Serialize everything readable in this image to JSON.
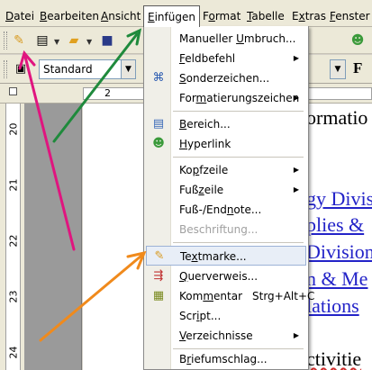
{
  "menubar": {
    "items": [
      {
        "label": "Datei",
        "u": "D"
      },
      {
        "label": "Bearbeiten",
        "u": "B"
      },
      {
        "label": "Ansicht",
        "u": "A"
      },
      {
        "label": "Einfügen",
        "u": "E"
      },
      {
        "label": "Format",
        "u": "o"
      },
      {
        "label": "Tabelle",
        "u": "T"
      },
      {
        "label": "Extras",
        "u": "x"
      },
      {
        "label": "Fenster",
        "u": "F"
      }
    ]
  },
  "toolbar": {
    "style_value": "Standard",
    "bold_label": "F",
    "icons": [
      "bookmark-icon",
      "new-document-icon",
      "open-folder-icon",
      "save-icon",
      "globe-icon"
    ]
  },
  "ruler": {
    "h_labels": [
      "1",
      "2",
      "1",
      "2"
    ],
    "v_labels": [
      "20",
      "21",
      "22",
      "23",
      "24"
    ]
  },
  "document": {
    "lines": [
      {
        "text": "ormatio",
        "class": ""
      },
      {
        "text": "gy Divis",
        "class": "blue"
      },
      {
        "text": "plies &",
        "class": "blue"
      },
      {
        "text": "Division",
        "class": "blue"
      },
      {
        "text": "n & Me",
        "class": "blue"
      },
      {
        "text": "lations",
        "class": "blue"
      },
      {
        "text": "ctivitie",
        "class": ""
      }
    ]
  },
  "menu": {
    "title": "Einfügen",
    "items": [
      {
        "label": "Manueller Umbruch...",
        "u": "U",
        "submenu": false,
        "icon": ""
      },
      {
        "label": "Feldbefehl",
        "u": "F",
        "submenu": true,
        "icon": ""
      },
      {
        "label": "Sonderzeichen...",
        "u": "S",
        "submenu": false,
        "icon": "special-char-icon"
      },
      {
        "label": "Formatierungszeichen",
        "u": "m",
        "submenu": true,
        "icon": ""
      },
      {
        "label": "Bereich...",
        "u": "B",
        "submenu": false,
        "icon": "section-icon"
      },
      {
        "label": "Hyperlink",
        "u": "H",
        "submenu": false,
        "icon": "hyperlink-icon"
      },
      {
        "label": "Kopfzeile",
        "u": "p",
        "submenu": true,
        "icon": ""
      },
      {
        "label": "Fußzeile",
        "u": "z",
        "submenu": true,
        "icon": ""
      },
      {
        "label": "Fuß-/Endnote...",
        "u": "n",
        "submenu": false,
        "icon": ""
      },
      {
        "label": "Beschriftung...",
        "u": "",
        "submenu": false,
        "icon": "",
        "disabled": true
      },
      {
        "label": "Textmarke...",
        "u": "x",
        "submenu": false,
        "icon": "bookmark-icon",
        "highlight": true
      },
      {
        "label": "Querverweis...",
        "u": "Q",
        "submenu": false,
        "icon": "cross-reference-icon"
      },
      {
        "label": "Kommentar",
        "u": "m",
        "submenu": false,
        "icon": "comment-icon",
        "shortcut": "Strg+Alt+C"
      },
      {
        "label": "Script...",
        "u": "i",
        "submenu": false,
        "icon": ""
      },
      {
        "label": "Verzeichnisse",
        "u": "V",
        "submenu": true,
        "icon": ""
      },
      {
        "label": "Briefumschlag...",
        "u": "r",
        "submenu": false,
        "icon": ""
      }
    ]
  },
  "colors": {
    "arrow_green": "#1f8a3c",
    "arrow_pink": "#e0157f",
    "arrow_orange": "#f08a1c",
    "link_blue": "#2323c8"
  }
}
